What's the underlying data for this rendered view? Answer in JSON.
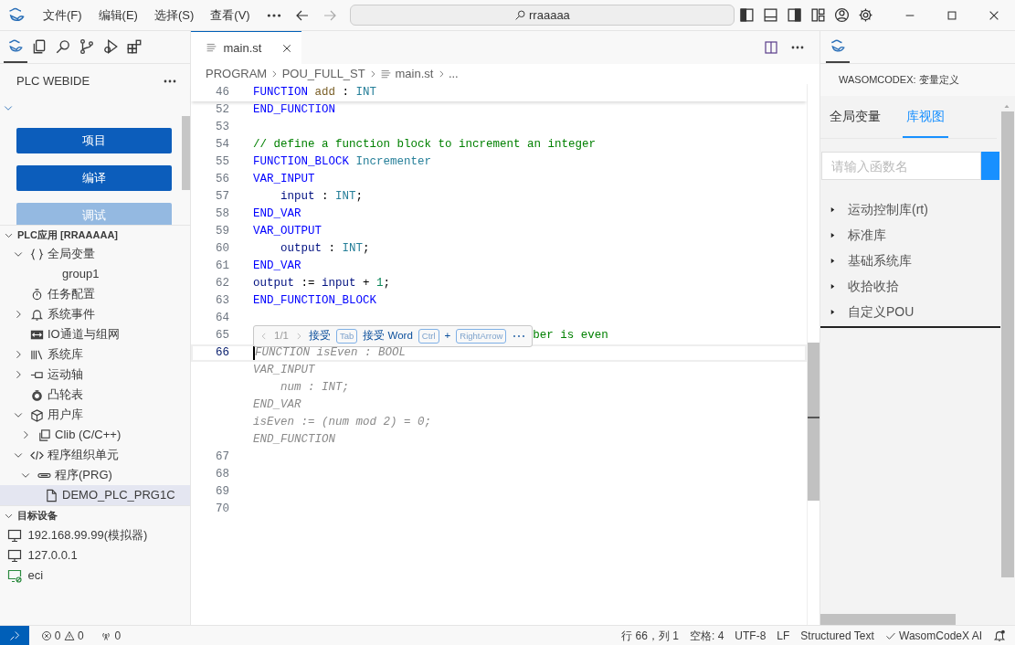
{
  "title_bar": {
    "menus": [
      "文件(F)",
      "编辑(E)",
      "选择(S)",
      "查看(V)"
    ],
    "search": "rraaaaa"
  },
  "activity_bar": {
    "items": [
      {
        "kind": "logo",
        "selected": true
      },
      {
        "kind": "files",
        "selected": false
      },
      {
        "kind": "search",
        "selected": false
      },
      {
        "kind": "branch",
        "selected": false
      },
      {
        "kind": "debug",
        "selected": false
      },
      {
        "kind": "extensions",
        "selected": false
      }
    ]
  },
  "sidebar": {
    "title": "PLC WEBIDE",
    "panel_expanded": true,
    "buttons": [
      {
        "label": "项目",
        "disabled": false
      },
      {
        "label": "编译",
        "disabled": false
      },
      {
        "label": "调试",
        "disabled": true
      }
    ],
    "tree": {
      "label": "PLC应用 [RRAAAAA]",
      "expanded": true,
      "children": [
        {
          "label": "全局变量",
          "kind": "braces",
          "expanded": true,
          "selected": false,
          "children": [
            {
              "label": "group1",
              "selected": false
            }
          ]
        },
        {
          "label": "任务配置",
          "kind": "watch",
          "selected": false
        },
        {
          "label": "系统事件",
          "kind": "bell",
          "expanded": false,
          "selected": false
        },
        {
          "label": "IO通道与组网",
          "kind": "io",
          "selected": false
        },
        {
          "label": "系统库",
          "kind": "library",
          "expanded": false,
          "selected": false
        },
        {
          "label": "运动轴",
          "kind": "axis",
          "expanded": false,
          "selected": false
        },
        {
          "label": "凸轮表",
          "kind": "cam",
          "selected": false
        },
        {
          "label": "用户库",
          "kind": "package",
          "expanded": true,
          "selected": false,
          "children": [
            {
              "label": "Clib (C/C++)",
              "kind": "copy",
              "expanded": false,
              "selected": false
            }
          ]
        },
        {
          "label": "程序组织单元",
          "kind": "code",
          "expanded": true,
          "selected": false,
          "children": [
            {
              "label": "程序(PRG)",
              "kind": "prg",
              "expanded": true,
              "selected": false,
              "children": [
                {
                  "label": "DEMO_PLC_PRG1C",
                  "kind": "file",
                  "selected": true
                }
              ]
            }
          ]
        }
      ]
    },
    "devices": {
      "label": "目标设备",
      "expanded": true,
      "items": [
        {
          "label": "192.168.99.99(模拟器)",
          "kind": "monitor"
        },
        {
          "label": "127.0.0.1",
          "kind": "monitor"
        },
        {
          "label": "eci",
          "kind": "offline"
        }
      ]
    }
  },
  "editor": {
    "tabs": [
      {
        "label": "main.st",
        "selected": true
      }
    ],
    "breadcrumb": [
      {
        "label": "PROGRAM",
        "kind": "folder"
      },
      {
        "label": "POU_FULL_ST",
        "kind": "folder"
      },
      {
        "label": "main.st",
        "kind": "file"
      },
      {
        "label": "...",
        "kind": "more"
      }
    ],
    "lines": [
      {
        "number": "46",
        "sticky": true,
        "tokens": [
          {
            "kind": "kw",
            "text": "FUNCTION"
          },
          {
            "kind": "fn",
            "text": " add"
          },
          {
            "kind": "tx",
            "text": " : "
          },
          {
            "kind": "ty",
            "text": "INT"
          }
        ]
      },
      {
        "number": "52",
        "tokens": [
          {
            "kind": "kw",
            "text": "END_FUNCTION"
          }
        ]
      },
      {
        "number": "53"
      },
      {
        "number": "54",
        "tokens": [
          {
            "kind": "cm",
            "text": "// define a function block to increment an integer"
          }
        ]
      },
      {
        "number": "55",
        "tokens": [
          {
            "kind": "kw",
            "text": "FUNCTION_BLOCK"
          },
          {
            "kind": "ty",
            "text": " Incrementer"
          }
        ]
      },
      {
        "number": "56",
        "tokens": [
          {
            "kind": "kw",
            "text": "VAR_INPUT"
          }
        ]
      },
      {
        "number": "57",
        "tokens": [
          {
            "kind": "var",
            "text": "    input"
          },
          {
            "kind": "tx",
            "text": " : "
          },
          {
            "kind": "ty",
            "text": "INT"
          },
          {
            "kind": "tx",
            "text": ";"
          }
        ]
      },
      {
        "number": "58",
        "tokens": [
          {
            "kind": "kw",
            "text": "END_VAR"
          }
        ]
      },
      {
        "number": "59",
        "tokens": [
          {
            "kind": "kw",
            "text": "VAR_OUTPUT"
          }
        ]
      },
      {
        "number": "60",
        "tokens": [
          {
            "kind": "var",
            "text": "    output"
          },
          {
            "kind": "tx",
            "text": " : "
          },
          {
            "kind": "ty",
            "text": "INT"
          },
          {
            "kind": "tx",
            "text": ";"
          }
        ]
      },
      {
        "number": "61",
        "tokens": [
          {
            "kind": "kw",
            "text": "END_VAR"
          }
        ]
      },
      {
        "number": "62",
        "tokens": [
          {
            "kind": "var",
            "text": "output"
          },
          {
            "kind": "tx",
            "text": " := "
          },
          {
            "kind": "var",
            "text": "input"
          },
          {
            "kind": "tx",
            "text": " + "
          },
          {
            "kind": "num",
            "text": "1"
          },
          {
            "kind": "tx",
            "text": ";"
          }
        ]
      },
      {
        "number": "63",
        "tokens": [
          {
            "kind": "kw",
            "text": "END_FUNCTION_BLOCK"
          }
        ]
      },
      {
        "number": "64"
      },
      {
        "number": "65",
        "suggestion_widget": {
          "counter": "1/1",
          "accept": "接受",
          "accept_key": "Tab",
          "accept_word": "接受 Word",
          "word_keys": [
            "Ctrl",
            "RightArrow"
          ],
          "plus": "+"
        },
        "tokens": [
          {
            "kind": "cm",
            "text": "ber is even"
          }
        ]
      },
      {
        "number": "66",
        "current": true,
        "ghost_text": "FUNCTION isEven : BOOL"
      },
      {
        "ghost_text": "VAR_INPUT"
      },
      {
        "ghost_text": "    num : INT;"
      },
      {
        "ghost_text": "END_VAR"
      },
      {
        "ghost_text": "isEven := (num mod 2) = 0;"
      },
      {
        "ghost_text": "END_FUNCTION"
      },
      {
        "number": "67"
      },
      {
        "number": "68"
      },
      {
        "number": "69"
      },
      {
        "number": "70"
      }
    ]
  },
  "right_panel": {
    "title": "WASOMCODEX: 变量定义",
    "tabs": [
      {
        "label": "全局变量",
        "selected": false
      },
      {
        "label": "库视图",
        "selected": true
      }
    ],
    "search_placeholder": "请输入函数名",
    "libraries": [
      "运动控制库(rt)",
      "标准库",
      "基础系统库",
      "收拾收拾",
      "自定义POU"
    ]
  },
  "status_bar": {
    "errors": "0",
    "warnings": "0",
    "ports": "0",
    "position": "行 66，列 1",
    "indent": "空格: 4",
    "encoding": "UTF-8",
    "eol": "LF",
    "language": "Structured Text",
    "ai": "WasomCodeX AI"
  }
}
